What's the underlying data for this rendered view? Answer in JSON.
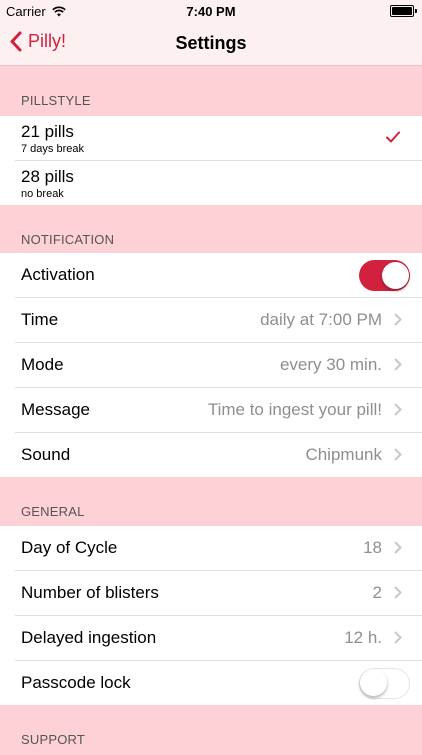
{
  "status": {
    "carrier": "Carrier",
    "time": "7:40 PM"
  },
  "nav": {
    "back_label": "Pilly!",
    "title": "Settings"
  },
  "sections": {
    "pillstyle": "PILLSTYLE",
    "notification": "NOTIFICATION",
    "general": "GENERAL",
    "support": "SUPPORT"
  },
  "pillstyle": [
    {
      "label": "21 pills",
      "sub": "7 days break",
      "selected": true
    },
    {
      "label": "28 pills",
      "sub": "no break",
      "selected": false
    }
  ],
  "notification": {
    "activation": {
      "label": "Activation",
      "on": true
    },
    "time": {
      "label": "Time",
      "value": "daily at 7:00 PM"
    },
    "mode": {
      "label": "Mode",
      "value": "every 30 min."
    },
    "message": {
      "label": "Message",
      "value": "Time to ingest your pill!"
    },
    "sound": {
      "label": "Sound",
      "value": "Chipmunk"
    }
  },
  "general": {
    "day_of_cycle": {
      "label": "Day of Cycle",
      "value": "18"
    },
    "blisters": {
      "label": "Number of blisters",
      "value": "2"
    },
    "delayed": {
      "label": "Delayed ingestion",
      "value": "12 h."
    },
    "passcode": {
      "label": "Passcode lock",
      "on": false
    }
  },
  "colors": {
    "accent": "#d1213f",
    "section_bg": "#fdd1d5",
    "bar_bg": "#fdf0f1"
  },
  "icons": [
    "wifi-icon",
    "battery-icon",
    "back-chevron-icon",
    "checkmark-icon",
    "chevron-right-icon"
  ]
}
